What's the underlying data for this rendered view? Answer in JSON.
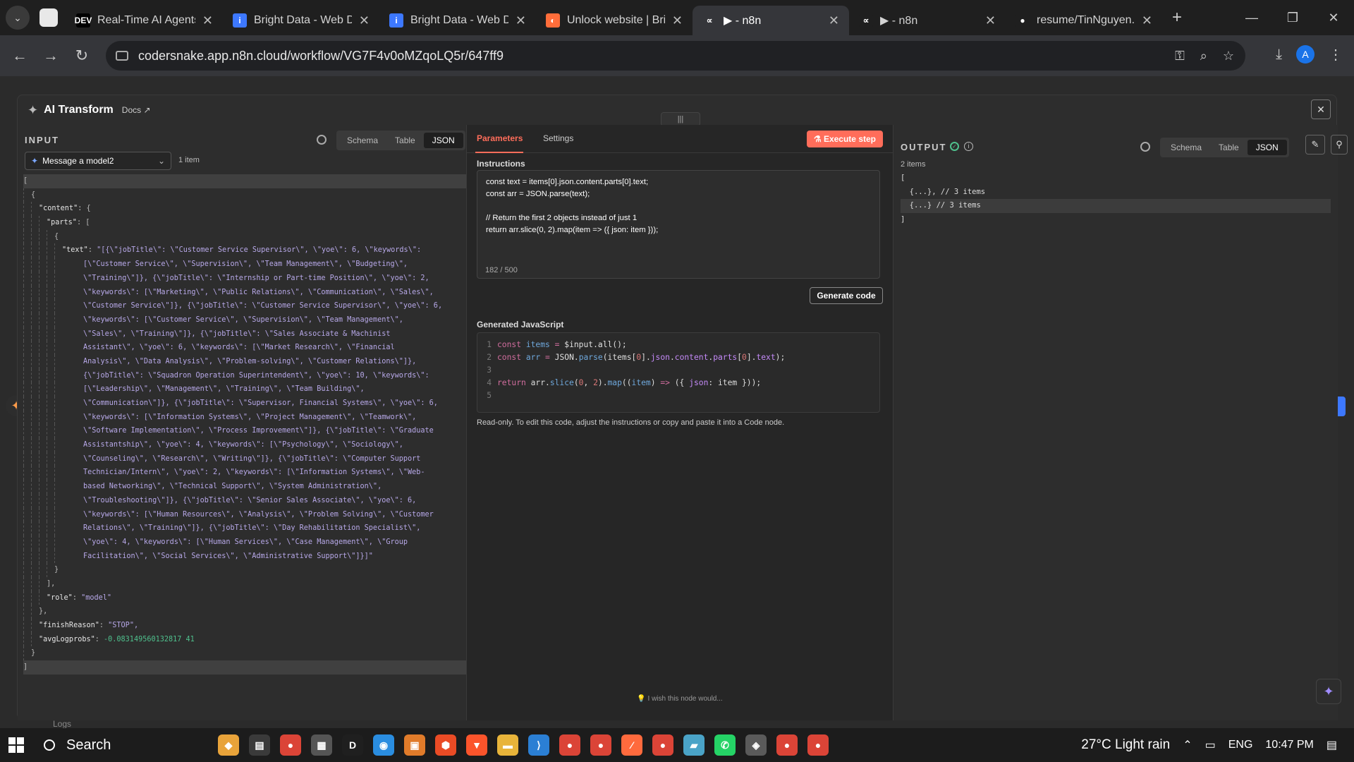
{
  "browser": {
    "tabs": [
      {
        "title": "Real-Time AI Agents",
        "favicon": "DEV",
        "color": "#000000"
      },
      {
        "title": "Bright Data - Web D",
        "favicon": "i",
        "color": "#3d78ff"
      },
      {
        "title": "Bright Data - Web D",
        "favicon": "i",
        "color": "#3d78ff"
      },
      {
        "title": "Unlock website | Bri",
        "favicon": "◐",
        "color": "#ff6d3a"
      },
      {
        "title": "▶ - n8n",
        "favicon": "∝",
        "color": "#35363a"
      },
      {
        "title": "▶ - n8n",
        "favicon": "∝",
        "color": "#1f1f1f"
      },
      {
        "title": "resume/TinNguyen.",
        "favicon": "●",
        "color": "#1f1f1f"
      }
    ],
    "url": "codersnake.app.n8n.cloud/workflow/VG7F4v0oMZqoLQ5r/647ff9",
    "profile_initial": "A"
  },
  "modal": {
    "title": "AI Transform",
    "docs_label": "Docs ↗",
    "close_label": "✕",
    "handle_label": "|||"
  },
  "input": {
    "label": "INPUT",
    "views": [
      "Schema",
      "Table",
      "JSON"
    ],
    "active_view": "JSON",
    "node_select": "Message a model2",
    "item_count": "1 item",
    "json_lines": [
      {
        "indent": 0,
        "text": "[",
        "cls": "p",
        "hl": true
      },
      {
        "indent": 1,
        "text": "{",
        "cls": "p"
      },
      {
        "indent": 2,
        "key": "\"content\"",
        "text": " {",
        "cls": "p"
      },
      {
        "indent": 3,
        "key": "\"parts\"",
        "text": " [",
        "cls": "p"
      },
      {
        "indent": 4,
        "text": "{",
        "cls": "p"
      },
      {
        "indent": 5,
        "key": "\"text\"",
        "text": " \"[{\\\"jobTitle\\\": \\\"Customer Service Supervisor\\\", \\\"yoe\\\": 6, \\\"keywords\\\":",
        "cls": "s"
      },
      {
        "indent": 5,
        "cont": true,
        "text": "[\\\"Customer Service\\\", \\\"Supervision\\\", \\\"Team Management\\\", \\\"Budgeting\\\",",
        "cls": "s"
      },
      {
        "indent": 5,
        "cont": true,
        "text": "\\\"Training\\\"]}, {\\\"jobTitle\\\": \\\"Internship or Part-time Position\\\", \\\"yoe\\\": 2,",
        "cls": "s"
      },
      {
        "indent": 5,
        "cont": true,
        "text": "\\\"keywords\\\": [\\\"Marketing\\\", \\\"Public Relations\\\", \\\"Communication\\\", \\\"Sales\\\",",
        "cls": "s"
      },
      {
        "indent": 5,
        "cont": true,
        "text": "\\\"Customer Service\\\"]}, {\\\"jobTitle\\\": \\\"Customer Service Supervisor\\\", \\\"yoe\\\": 6,",
        "cls": "s"
      },
      {
        "indent": 5,
        "cont": true,
        "text": "\\\"keywords\\\": [\\\"Customer Service\\\", \\\"Supervision\\\", \\\"Team Management\\\",",
        "cls": "s"
      },
      {
        "indent": 5,
        "cont": true,
        "text": "\\\"Sales\\\", \\\"Training\\\"]}, {\\\"jobTitle\\\": \\\"Sales Associate & Machinist",
        "cls": "s"
      },
      {
        "indent": 5,
        "cont": true,
        "text": "Assistant\\\", \\\"yoe\\\": 6, \\\"keywords\\\": [\\\"Market Research\\\", \\\"Financial",
        "cls": "s"
      },
      {
        "indent": 5,
        "cont": true,
        "text": "Analysis\\\", \\\"Data Analysis\\\", \\\"Problem-solving\\\", \\\"Customer Relations\\\"]},",
        "cls": "s"
      },
      {
        "indent": 5,
        "cont": true,
        "text": "{\\\"jobTitle\\\": \\\"Squadron Operation Superintendent\\\", \\\"yoe\\\": 10, \\\"keywords\\\":",
        "cls": "s"
      },
      {
        "indent": 5,
        "cont": true,
        "text": "[\\\"Leadership\\\", \\\"Management\\\", \\\"Training\\\", \\\"Team Building\\\",",
        "cls": "s"
      },
      {
        "indent": 5,
        "cont": true,
        "text": "\\\"Communication\\\"]}, {\\\"jobTitle\\\": \\\"Supervisor, Financial Systems\\\", \\\"yoe\\\": 6,",
        "cls": "s"
      },
      {
        "indent": 5,
        "cont": true,
        "text": "\\\"keywords\\\": [\\\"Information Systems\\\", \\\"Project Management\\\", \\\"Teamwork\\\",",
        "cls": "s"
      },
      {
        "indent": 5,
        "cont": true,
        "text": "\\\"Software Implementation\\\", \\\"Process Improvement\\\"]}, {\\\"jobTitle\\\": \\\"Graduate",
        "cls": "s"
      },
      {
        "indent": 5,
        "cont": true,
        "text": "Assistantship\\\", \\\"yoe\\\": 4, \\\"keywords\\\": [\\\"Psychology\\\", \\\"Sociology\\\",",
        "cls": "s"
      },
      {
        "indent": 5,
        "cont": true,
        "text": "\\\"Counseling\\\", \\\"Research\\\", \\\"Writing\\\"]}, {\\\"jobTitle\\\": \\\"Computer Support",
        "cls": "s"
      },
      {
        "indent": 5,
        "cont": true,
        "text": "Technician/Intern\\\", \\\"yoe\\\": 2, \\\"keywords\\\": [\\\"Information Systems\\\", \\\"Web-",
        "cls": "s"
      },
      {
        "indent": 5,
        "cont": true,
        "text": "based Networking\\\", \\\"Technical Support\\\", \\\"System Administration\\\",",
        "cls": "s"
      },
      {
        "indent": 5,
        "cont": true,
        "text": "\\\"Troubleshooting\\\"]}, {\\\"jobTitle\\\": \\\"Senior Sales Associate\\\", \\\"yoe\\\": 6,",
        "cls": "s"
      },
      {
        "indent": 5,
        "cont": true,
        "text": "\\\"keywords\\\": [\\\"Human Resources\\\", \\\"Analysis\\\", \\\"Problem Solving\\\", \\\"Customer",
        "cls": "s"
      },
      {
        "indent": 5,
        "cont": true,
        "text": "Relations\\\", \\\"Training\\\"]}, {\\\"jobTitle\\\": \\\"Day Rehabilitation Specialist\\\",",
        "cls": "s"
      },
      {
        "indent": 5,
        "cont": true,
        "text": "\\\"yoe\\\": 4, \\\"keywords\\\": [\\\"Human Services\\\", \\\"Case Management\\\", \\\"Group",
        "cls": "s"
      },
      {
        "indent": 5,
        "cont": true,
        "text": "Facilitation\\\", \\\"Social Services\\\", \\\"Administrative Support\\\"]}]\"",
        "cls": "s"
      },
      {
        "indent": 4,
        "text": "}",
        "cls": "p"
      },
      {
        "indent": 3,
        "text": "],",
        "cls": "p"
      },
      {
        "indent": 3,
        "key": "\"role\"",
        "text": " \"model\"",
        "cls": "s"
      },
      {
        "indent": 2,
        "text": "},",
        "cls": "p"
      },
      {
        "indent": 2,
        "key": "\"finishReason\"",
        "text": " \"STOP\",",
        "cls": "s"
      },
      {
        "indent": 2,
        "key": "\"avgLogprobs\"",
        "text": " -0.083149560132817 41",
        "cls": "n"
      },
      {
        "indent": 1,
        "text": "}",
        "cls": "p"
      },
      {
        "indent": 0,
        "text": "]",
        "cls": "p",
        "hl": true
      }
    ]
  },
  "parameters": {
    "tabs": [
      "Parameters",
      "Settings"
    ],
    "active_tab": "Parameters",
    "execute_label": "Execute step",
    "instructions_label": "Instructions",
    "instructions_lines": [
      "const text = items[0].json.content.parts[0].text;",
      "const arr = JSON.parse(text);",
      "",
      "// Return the first 2 objects instead of just 1",
      "return arr.slice(0, 2).map(item => ({ json: item }));"
    ],
    "char_count": "182 / 500",
    "generate_label": "Generate code",
    "generated_label": "Generated JavaScript",
    "readonly_note": "Read-only. To edit this code, adjust the instructions or copy and paste it into a Code node.",
    "wish_note": "I wish this node would..."
  },
  "output": {
    "label": "OUTPUT",
    "views": [
      "Schema",
      "Table",
      "JSON"
    ],
    "active_view": "JSON",
    "item_count": "2 items",
    "json_lines": [
      {
        "text": "[",
        "hl": false
      },
      {
        "text": "  {...}, // 3 items",
        "hl": false
      },
      {
        "text": "  {...} // 3 items",
        "hl": true
      },
      {
        "text": "]",
        "hl": false
      }
    ]
  },
  "logs_label": "Logs",
  "taskbar": {
    "search_label": "Search",
    "weather": "27°C  Light rain",
    "language": "ENG",
    "time": "10:47 PM",
    "apps": [
      {
        "color": "#e8a33a",
        "glyph": "◆"
      },
      {
        "color": "#3a3a3a",
        "glyph": "▤"
      },
      {
        "color": "#db4437",
        "glyph": "●"
      },
      {
        "color": "#555555",
        "glyph": "▦"
      },
      {
        "color": "#1f1f1f",
        "glyph": "D"
      },
      {
        "color": "#2a8de0",
        "glyph": "◉"
      },
      {
        "color": "#e07b2a",
        "glyph": "▣"
      },
      {
        "color": "#ea4b25",
        "glyph": "⬢"
      },
      {
        "color": "#fb542b",
        "glyph": "▼"
      },
      {
        "color": "#e8b43a",
        "glyph": "▬"
      },
      {
        "color": "#2b7fd4",
        "glyph": "⟩"
      },
      {
        "color": "#db4437",
        "glyph": "●"
      },
      {
        "color": "#db4437",
        "glyph": "●"
      },
      {
        "color": "#ff6a3d",
        "glyph": "⁄"
      },
      {
        "color": "#db4437",
        "glyph": "●"
      },
      {
        "color": "#4aa3c7",
        "glyph": "▰"
      },
      {
        "color": "#25d366",
        "glyph": "✆"
      },
      {
        "color": "#5a5a5a",
        "glyph": "◈"
      },
      {
        "color": "#db4437",
        "glyph": "●"
      },
      {
        "color": "#db4437",
        "glyph": "●"
      }
    ]
  }
}
